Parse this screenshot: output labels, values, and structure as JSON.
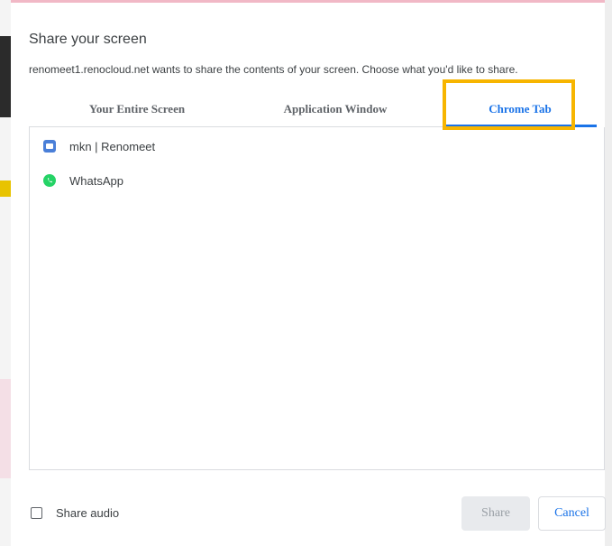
{
  "dialog": {
    "title": "Share your screen",
    "description": "renomeet1.renocloud.net wants to share the contents of your screen. Choose what you'd like to share."
  },
  "tabs": [
    {
      "label": "Your Entire Screen",
      "selected": false
    },
    {
      "label": "Application Window",
      "selected": false
    },
    {
      "label": "Chrome Tab",
      "selected": true
    }
  ],
  "list": {
    "items": [
      {
        "label": "mkn | Renomeet",
        "icon": "renomeet-favicon-icon"
      },
      {
        "label": "WhatsApp",
        "icon": "whatsapp-icon"
      }
    ]
  },
  "footer": {
    "share_audio_label": "Share audio",
    "share_audio_checked": false,
    "share_button_label": "Share",
    "cancel_button_label": "Cancel"
  },
  "colors": {
    "accent": "#1a73e8",
    "highlight": "#f7b500",
    "whatsapp": "#25d366",
    "disabled_bg": "#e8eaed"
  }
}
